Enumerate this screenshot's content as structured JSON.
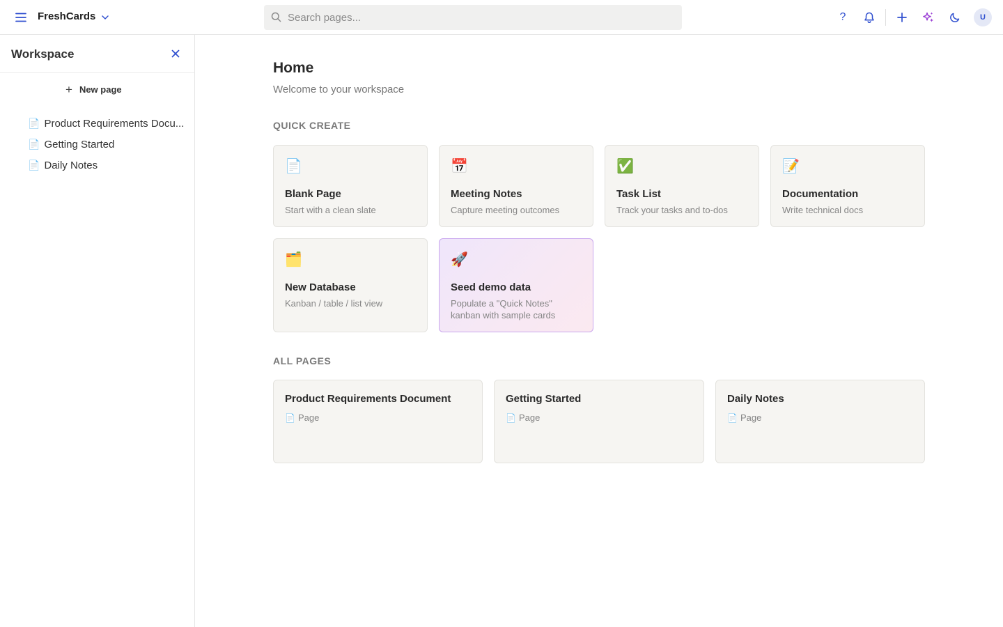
{
  "app": {
    "title": "FreshCards"
  },
  "search": {
    "placeholder": "Search pages..."
  },
  "topbar": {
    "help_label": "?",
    "avatar_initial": "U"
  },
  "sidebar": {
    "title": "Workspace",
    "new_page_label": "New page",
    "items": [
      {
        "icon": "📄",
        "label": "Product Requirements Docu..."
      },
      {
        "icon": "📄",
        "label": "Getting Started"
      },
      {
        "icon": "📄",
        "label": "Daily Notes"
      }
    ]
  },
  "main": {
    "title": "Home",
    "subtitle": "Welcome to your workspace",
    "quick_create_heading": "QUICK CREATE",
    "quick_create": [
      {
        "emoji": "📄",
        "title": "Blank Page",
        "desc": "Start with a clean slate"
      },
      {
        "emoji": "📅",
        "title": "Meeting Notes",
        "desc": "Capture meeting outcomes"
      },
      {
        "emoji": "✅",
        "title": "Task List",
        "desc": "Track your tasks and to-dos"
      },
      {
        "emoji": "📝",
        "title": "Documentation",
        "desc": "Write technical docs"
      },
      {
        "emoji": "🗂️",
        "title": "New Database",
        "desc": "Kanban / table / list view"
      },
      {
        "emoji": "🚀",
        "title": "Seed demo data",
        "desc": "Populate a \"Quick Notes\" kanban with sample cards"
      }
    ],
    "all_pages_heading": "ALL PAGES",
    "pages": [
      {
        "title": "Product Requirements Document",
        "icon": "📄",
        "type": "Page"
      },
      {
        "title": "Getting Started",
        "icon": "📄",
        "type": "Page"
      },
      {
        "title": "Daily Notes",
        "icon": "📄",
        "type": "Page"
      }
    ]
  },
  "colors": {
    "accent": "#2f4fcf",
    "sparkle": "#9b3fd6",
    "seed_border": "#c9a6ee"
  }
}
